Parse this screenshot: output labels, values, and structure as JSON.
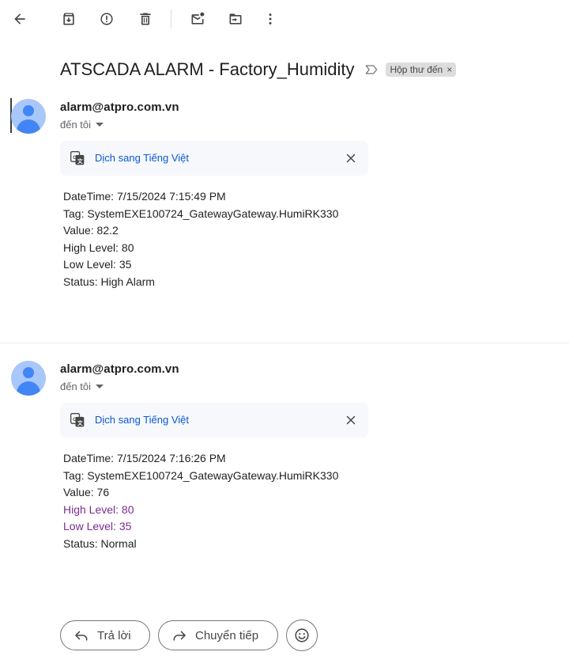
{
  "toolbar": {
    "buttons": [
      {
        "icon": "back-arrow-icon"
      },
      {
        "icon": "archive-icon"
      },
      {
        "icon": "report-spam-icon"
      },
      {
        "icon": "delete-icon"
      },
      {
        "icon": "mark-unread-icon"
      },
      {
        "icon": "move-to-icon"
      },
      {
        "icon": "more-vert-icon"
      }
    ]
  },
  "subject": {
    "title": "ATSCADA ALARM - Factory_Humidity",
    "label_chip": "Hộp thư đến",
    "chip_close": "×"
  },
  "messages": [
    {
      "sender": "alarm@atpro.com.vn",
      "recipient": "đến tôi",
      "translate_label": "Dịch sang Tiếng Việt",
      "lines": [
        {
          "text": "DateTime: 7/15/2024 7:15:49 PM",
          "color": "#222222"
        },
        {
          "text": "Tag: SystemEXE100724_GatewayGateway.HumiRK330",
          "color": "#222222"
        },
        {
          "text": "Value: 82.2",
          "color": "#222222"
        },
        {
          "text": "High Level: 80",
          "color": "#222222"
        },
        {
          "text": "Low Level: 35",
          "color": "#222222"
        },
        {
          "text": "Status: High Alarm",
          "color": "#222222"
        }
      ]
    },
    {
      "sender": "alarm@atpro.com.vn",
      "recipient": "đến tôi",
      "translate_label": "Dịch sang Tiếng Việt",
      "lines": [
        {
          "text": "DateTime: 7/15/2024 7:16:26 PM",
          "color": "#222222"
        },
        {
          "text": "Tag: SystemEXE100724_GatewayGateway.HumiRK330",
          "color": "#222222"
        },
        {
          "text": "Value: 76",
          "color": "#222222"
        },
        {
          "text": "High Level: 80",
          "color": "#7b2c8f"
        },
        {
          "text": "Low Level: 35",
          "color": "#7b2c8f"
        },
        {
          "text": "Status: Normal",
          "color": "#222222"
        }
      ]
    }
  ],
  "actions": {
    "reply_label": "Trả lời",
    "forward_label": "Chuyển tiếp"
  },
  "colors": {
    "link": "#0b57d0",
    "avatar_bg": "#a8c7fa",
    "avatar_fg": "#4285f4",
    "visited_text": "#7b2c8f"
  }
}
